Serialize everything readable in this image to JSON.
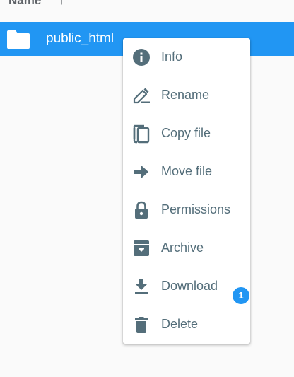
{
  "list_header": {
    "name_column": "Name",
    "sort_indicator": "↑"
  },
  "selected_file": {
    "name": "public_html",
    "icon": "folder-icon",
    "type": "folder"
  },
  "context_menu": {
    "items": [
      {
        "label": "Info",
        "icon": "info-icon"
      },
      {
        "label": "Rename",
        "icon": "rename-icon"
      },
      {
        "label": "Copy file",
        "icon": "copy-icon"
      },
      {
        "label": "Move file",
        "icon": "move-arrow-icon"
      },
      {
        "label": "Permissions",
        "icon": "lock-icon"
      },
      {
        "label": "Archive",
        "icon": "archive-icon"
      },
      {
        "label": "Download",
        "icon": "download-icon"
      },
      {
        "label": "Delete",
        "icon": "trash-icon"
      }
    ]
  },
  "badge": {
    "count": "1"
  },
  "colors": {
    "accent": "#2196f3",
    "icon": "#546e7a",
    "text": "#546e7a",
    "background": "#fafafa",
    "menu_background": "#ffffff"
  }
}
